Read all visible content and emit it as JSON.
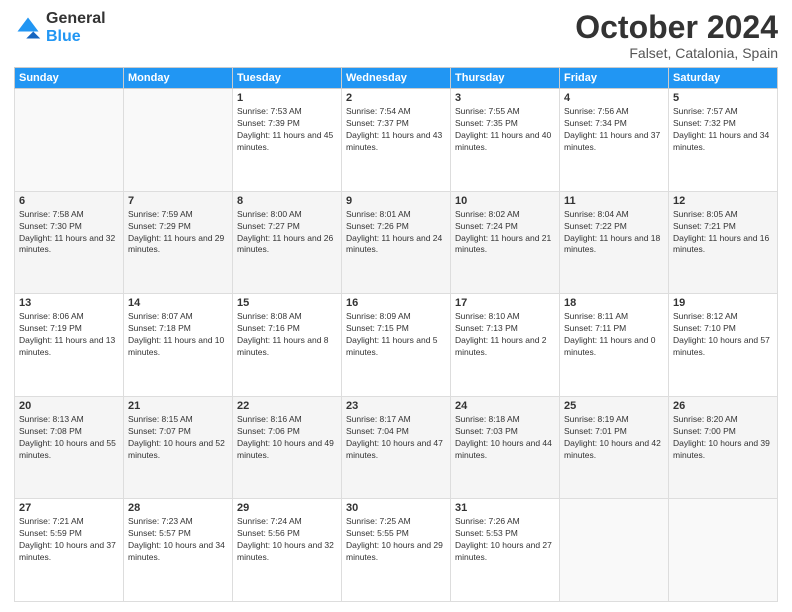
{
  "header": {
    "logo_general": "General",
    "logo_blue": "Blue",
    "title": "October 2024",
    "location": "Falset, Catalonia, Spain"
  },
  "days_of_week": [
    "Sunday",
    "Monday",
    "Tuesday",
    "Wednesday",
    "Thursday",
    "Friday",
    "Saturday"
  ],
  "weeks": [
    [
      {
        "day": "",
        "info": ""
      },
      {
        "day": "",
        "info": ""
      },
      {
        "day": "1",
        "sunrise": "Sunrise: 7:53 AM",
        "sunset": "Sunset: 7:39 PM",
        "daylight": "Daylight: 11 hours and 45 minutes."
      },
      {
        "day": "2",
        "sunrise": "Sunrise: 7:54 AM",
        "sunset": "Sunset: 7:37 PM",
        "daylight": "Daylight: 11 hours and 43 minutes."
      },
      {
        "day": "3",
        "sunrise": "Sunrise: 7:55 AM",
        "sunset": "Sunset: 7:35 PM",
        "daylight": "Daylight: 11 hours and 40 minutes."
      },
      {
        "day": "4",
        "sunrise": "Sunrise: 7:56 AM",
        "sunset": "Sunset: 7:34 PM",
        "daylight": "Daylight: 11 hours and 37 minutes."
      },
      {
        "day": "5",
        "sunrise": "Sunrise: 7:57 AM",
        "sunset": "Sunset: 7:32 PM",
        "daylight": "Daylight: 11 hours and 34 minutes."
      }
    ],
    [
      {
        "day": "6",
        "sunrise": "Sunrise: 7:58 AM",
        "sunset": "Sunset: 7:30 PM",
        "daylight": "Daylight: 11 hours and 32 minutes."
      },
      {
        "day": "7",
        "sunrise": "Sunrise: 7:59 AM",
        "sunset": "Sunset: 7:29 PM",
        "daylight": "Daylight: 11 hours and 29 minutes."
      },
      {
        "day": "8",
        "sunrise": "Sunrise: 8:00 AM",
        "sunset": "Sunset: 7:27 PM",
        "daylight": "Daylight: 11 hours and 26 minutes."
      },
      {
        "day": "9",
        "sunrise": "Sunrise: 8:01 AM",
        "sunset": "Sunset: 7:26 PM",
        "daylight": "Daylight: 11 hours and 24 minutes."
      },
      {
        "day": "10",
        "sunrise": "Sunrise: 8:02 AM",
        "sunset": "Sunset: 7:24 PM",
        "daylight": "Daylight: 11 hours and 21 minutes."
      },
      {
        "day": "11",
        "sunrise": "Sunrise: 8:04 AM",
        "sunset": "Sunset: 7:22 PM",
        "daylight": "Daylight: 11 hours and 18 minutes."
      },
      {
        "day": "12",
        "sunrise": "Sunrise: 8:05 AM",
        "sunset": "Sunset: 7:21 PM",
        "daylight": "Daylight: 11 hours and 16 minutes."
      }
    ],
    [
      {
        "day": "13",
        "sunrise": "Sunrise: 8:06 AM",
        "sunset": "Sunset: 7:19 PM",
        "daylight": "Daylight: 11 hours and 13 minutes."
      },
      {
        "day": "14",
        "sunrise": "Sunrise: 8:07 AM",
        "sunset": "Sunset: 7:18 PM",
        "daylight": "Daylight: 11 hours and 10 minutes."
      },
      {
        "day": "15",
        "sunrise": "Sunrise: 8:08 AM",
        "sunset": "Sunset: 7:16 PM",
        "daylight": "Daylight: 11 hours and 8 minutes."
      },
      {
        "day": "16",
        "sunrise": "Sunrise: 8:09 AM",
        "sunset": "Sunset: 7:15 PM",
        "daylight": "Daylight: 11 hours and 5 minutes."
      },
      {
        "day": "17",
        "sunrise": "Sunrise: 8:10 AM",
        "sunset": "Sunset: 7:13 PM",
        "daylight": "Daylight: 11 hours and 2 minutes."
      },
      {
        "day": "18",
        "sunrise": "Sunrise: 8:11 AM",
        "sunset": "Sunset: 7:11 PM",
        "daylight": "Daylight: 11 hours and 0 minutes."
      },
      {
        "day": "19",
        "sunrise": "Sunrise: 8:12 AM",
        "sunset": "Sunset: 7:10 PM",
        "daylight": "Daylight: 10 hours and 57 minutes."
      }
    ],
    [
      {
        "day": "20",
        "sunrise": "Sunrise: 8:13 AM",
        "sunset": "Sunset: 7:08 PM",
        "daylight": "Daylight: 10 hours and 55 minutes."
      },
      {
        "day": "21",
        "sunrise": "Sunrise: 8:15 AM",
        "sunset": "Sunset: 7:07 PM",
        "daylight": "Daylight: 10 hours and 52 minutes."
      },
      {
        "day": "22",
        "sunrise": "Sunrise: 8:16 AM",
        "sunset": "Sunset: 7:06 PM",
        "daylight": "Daylight: 10 hours and 49 minutes."
      },
      {
        "day": "23",
        "sunrise": "Sunrise: 8:17 AM",
        "sunset": "Sunset: 7:04 PM",
        "daylight": "Daylight: 10 hours and 47 minutes."
      },
      {
        "day": "24",
        "sunrise": "Sunrise: 8:18 AM",
        "sunset": "Sunset: 7:03 PM",
        "daylight": "Daylight: 10 hours and 44 minutes."
      },
      {
        "day": "25",
        "sunrise": "Sunrise: 8:19 AM",
        "sunset": "Sunset: 7:01 PM",
        "daylight": "Daylight: 10 hours and 42 minutes."
      },
      {
        "day": "26",
        "sunrise": "Sunrise: 8:20 AM",
        "sunset": "Sunset: 7:00 PM",
        "daylight": "Daylight: 10 hours and 39 minutes."
      }
    ],
    [
      {
        "day": "27",
        "sunrise": "Sunrise: 7:21 AM",
        "sunset": "Sunset: 5:59 PM",
        "daylight": "Daylight: 10 hours and 37 minutes."
      },
      {
        "day": "28",
        "sunrise": "Sunrise: 7:23 AM",
        "sunset": "Sunset: 5:57 PM",
        "daylight": "Daylight: 10 hours and 34 minutes."
      },
      {
        "day": "29",
        "sunrise": "Sunrise: 7:24 AM",
        "sunset": "Sunset: 5:56 PM",
        "daylight": "Daylight: 10 hours and 32 minutes."
      },
      {
        "day": "30",
        "sunrise": "Sunrise: 7:25 AM",
        "sunset": "Sunset: 5:55 PM",
        "daylight": "Daylight: 10 hours and 29 minutes."
      },
      {
        "day": "31",
        "sunrise": "Sunrise: 7:26 AM",
        "sunset": "Sunset: 5:53 PM",
        "daylight": "Daylight: 10 hours and 27 minutes."
      },
      {
        "day": "",
        "info": ""
      },
      {
        "day": "",
        "info": ""
      }
    ]
  ]
}
